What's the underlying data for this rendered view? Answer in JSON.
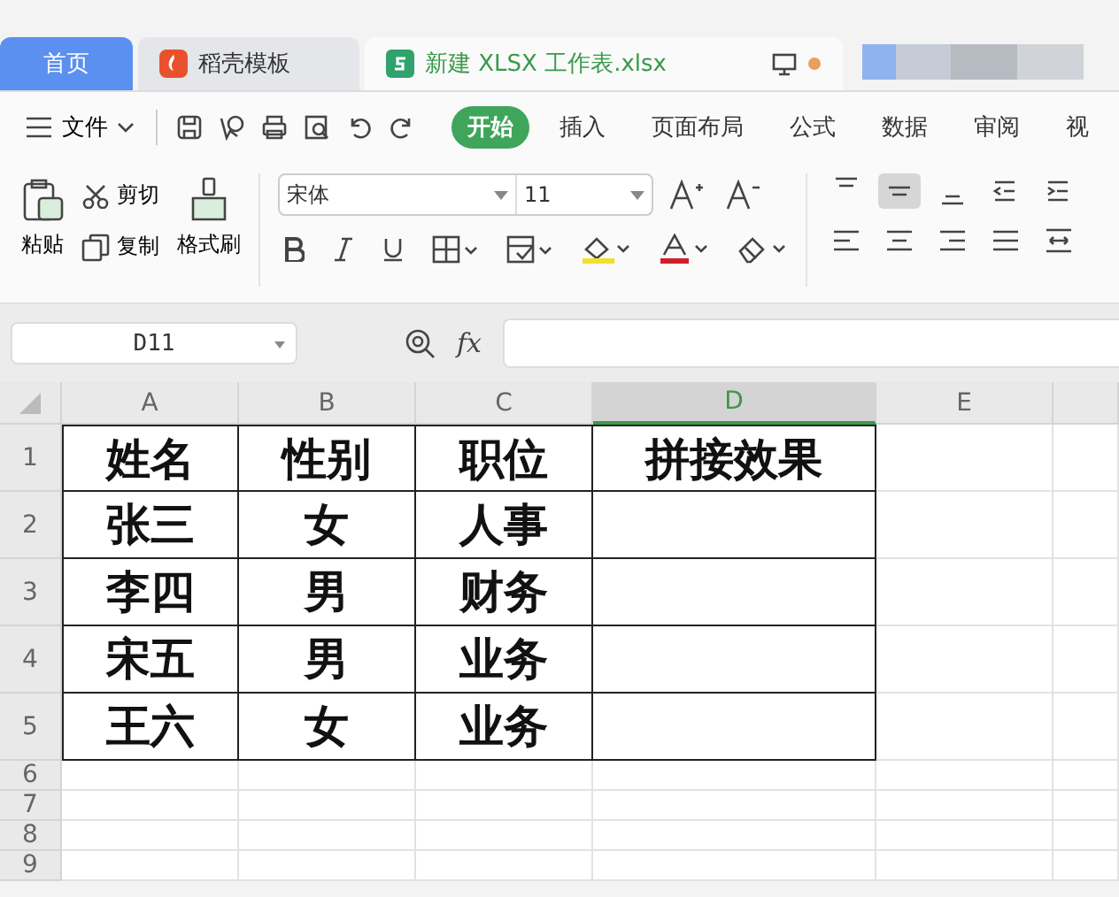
{
  "tabs": [
    {
      "kind": "home",
      "label": "首页",
      "selected": false
    },
    {
      "kind": "template",
      "label": "稻壳模板",
      "selected": false
    },
    {
      "kind": "sheet",
      "label": "新建 XLSX 工作表.xlsx",
      "selected": true
    }
  ],
  "menu": {
    "file": "文件",
    "tabs": [
      {
        "label": "开始",
        "selected": true
      },
      {
        "label": "插入",
        "selected": false
      },
      {
        "label": "页面布局",
        "selected": false
      },
      {
        "label": "公式",
        "selected": false
      },
      {
        "label": "数据",
        "selected": false
      },
      {
        "label": "审阅",
        "selected": false
      },
      {
        "label": "视",
        "selected": false
      }
    ]
  },
  "ribbon": {
    "paste": "粘贴",
    "cut": "剪切",
    "copy": "复制",
    "format_painter": "格式刷",
    "font": "宋体",
    "size": "11",
    "align_top": [
      {
        "kind": "top",
        "selected": false
      },
      {
        "kind": "middle",
        "selected": true
      },
      {
        "kind": "bottom",
        "selected": false
      },
      {
        "kind": "outdent",
        "selected": false
      },
      {
        "kind": "indent",
        "selected": false
      }
    ]
  },
  "formula_bar": {
    "name_box": "D11",
    "fx": "fx"
  },
  "sheet": {
    "columns": [
      {
        "label": "A",
        "selected": false
      },
      {
        "label": "B",
        "selected": false
      },
      {
        "label": "C",
        "selected": false
      },
      {
        "label": "D",
        "selected": true
      },
      {
        "label": "E",
        "selected": false
      }
    ],
    "rows": [
      {
        "number": "1",
        "cells": [
          "姓名",
          "性别",
          "职位",
          "拼接效果"
        ]
      },
      {
        "number": "2",
        "cells": [
          "张三",
          "女",
          "人事",
          ""
        ]
      },
      {
        "number": "3",
        "cells": [
          "李四",
          "男",
          "财务",
          ""
        ]
      },
      {
        "number": "4",
        "cells": [
          "宋五",
          "男",
          "业务",
          ""
        ]
      },
      {
        "number": "5",
        "cells": [
          "王六",
          "女",
          "业务",
          ""
        ]
      },
      {
        "number": "6",
        "cells": []
      },
      {
        "number": "7",
        "cells": []
      },
      {
        "number": "8",
        "cells": []
      },
      {
        "number": "9",
        "cells": []
      }
    ]
  }
}
